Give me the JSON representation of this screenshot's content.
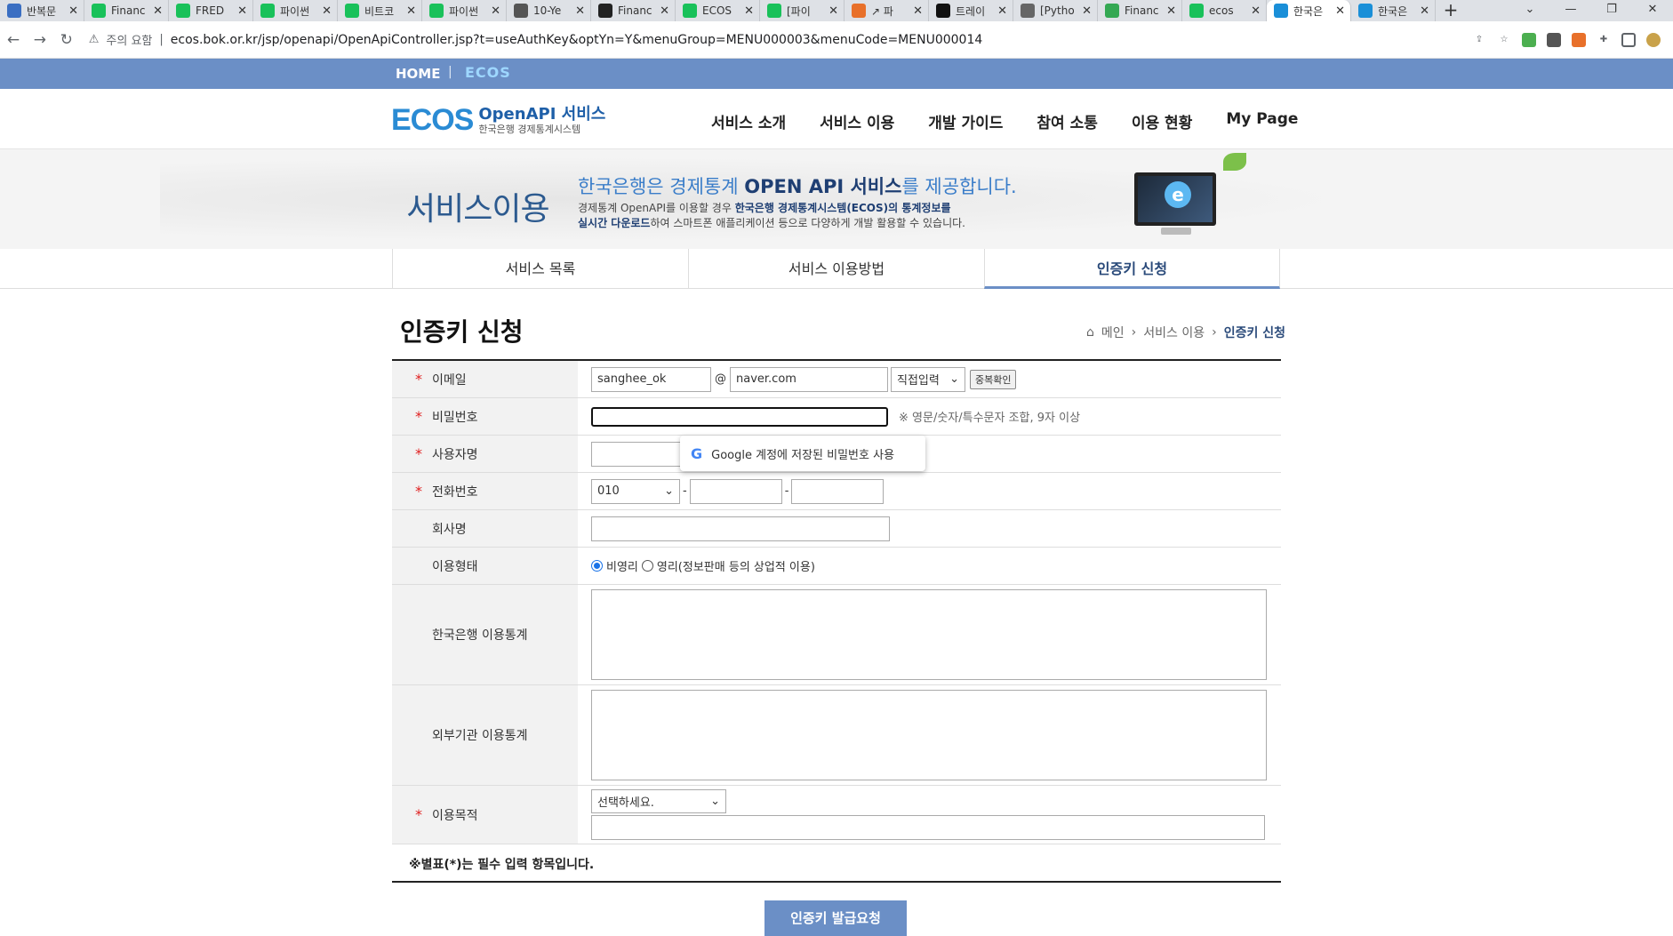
{
  "browser": {
    "tabs": [
      {
        "label": "반복문",
        "color": "#3a6ec2",
        "icon": "code-icon"
      },
      {
        "label": "Financ",
        "color": "#19c15a",
        "icon": "naver-icon"
      },
      {
        "label": "FRED",
        "color": "#19c15a",
        "icon": "blog-icon"
      },
      {
        "label": "파이썬",
        "color": "#19c15a",
        "icon": "blog-icon"
      },
      {
        "label": "비트코",
        "color": "#19c15a",
        "icon": "blog-icon"
      },
      {
        "label": "파이썬",
        "color": "#19c15a",
        "icon": "blog-icon"
      },
      {
        "label": "10-Ye",
        "color": "#555555",
        "icon": "chart-icon"
      },
      {
        "label": "Financ",
        "color": "#222222",
        "icon": "github-icon"
      },
      {
        "label": "ECOS",
        "color": "#19c15a",
        "icon": "naver-icon"
      },
      {
        "label": "[파이",
        "color": "#19c15a",
        "icon": "blog-icon"
      },
      {
        "label": "↗ 파",
        "color": "#e8702a",
        "icon": "orange-icon"
      },
      {
        "label": "트레이",
        "color": "#111111",
        "icon": "tv-icon"
      },
      {
        "label": "[Pytho",
        "color": "#666666",
        "icon": "dots-icon"
      },
      {
        "label": "Financ",
        "color": "#34a853",
        "icon": "sheets-icon"
      },
      {
        "label": "ecos",
        "color": "#19c15a",
        "icon": "naver-icon"
      },
      {
        "label": "한국은",
        "color": "#1a8fd8",
        "icon": "bok-icon"
      },
      {
        "label": "한국은",
        "color": "#1a8fd8",
        "icon": "bok-icon"
      }
    ],
    "active_tab_index": 15,
    "url_warning": "주의 요함",
    "url": "ecos.bok.or.kr/jsp/openapi/OpenApiController.jsp?t=useAuthKey&optYn=Y&menuGroup=MENU000003&menuCode=MENU000014"
  },
  "topbar": {
    "home": "HOME",
    "sep": "|",
    "ecos": "ECOS"
  },
  "logo": {
    "main": "ECOS",
    "sub1": "OpenAPI 서비스",
    "sub2": "한국은행 경제통계시스템"
  },
  "menu": [
    "서비스 소개",
    "서비스 이용",
    "개발 가이드",
    "참여 소통",
    "이용 현황",
    "My Page"
  ],
  "banner": {
    "title": "서비스이용",
    "headline_a": "한국은행은 경제통계 ",
    "headline_b": "OPEN API 서비스",
    "headline_c": "를 제공합니다.",
    "line1_a": "경제통계 OpenAPI를 이용할 경우 ",
    "line1_b": "한국은행 경제통계시스템(ECOS)의 통계정보를",
    "line2_a": "실시간 다운로드",
    "line2_b": "하여 스마트폰 애플리케이션 등으로 다양하게 개발 활용할 수 있습니다."
  },
  "subtabs": [
    "서비스 목록",
    "서비스 이용방법",
    "인증키 신청"
  ],
  "page_title": "인증키 신청",
  "breadcrumb": {
    "home": "메인",
    "mid": "서비스 이용",
    "current": "인증키 신청"
  },
  "form": {
    "email_label": "이메일",
    "email_id": "sanghee_ok",
    "at": "@",
    "email_domain": "naver.com",
    "email_select": "직접입력",
    "dup_check": "중복확인",
    "password_label": "비밀번호",
    "password_hint": "※ 영문/숫자/특수문자 조합, 9자 이상",
    "username_label": "사용자명",
    "phone_label": "전화번호",
    "phone_prefix": "010",
    "dash": "-",
    "company_label": "회사명",
    "usage_type_label": "이용형태",
    "usage_nonprofit": "비영리",
    "usage_profit": "영리(정보판매 등의 상업적 이용)",
    "bok_stats_label": "한국은행 이용통계",
    "ext_stats_label": "외부기관 이용통계",
    "purpose_label": "이용목적",
    "purpose_select": "선택하세요."
  },
  "google_popup": {
    "g": "G",
    "text": "Google 계정에 저장된 비밀번호 사용"
  },
  "note": "※별표(*)는 필수 입력 항목입니다.",
  "submit": "인증키 발급요청"
}
